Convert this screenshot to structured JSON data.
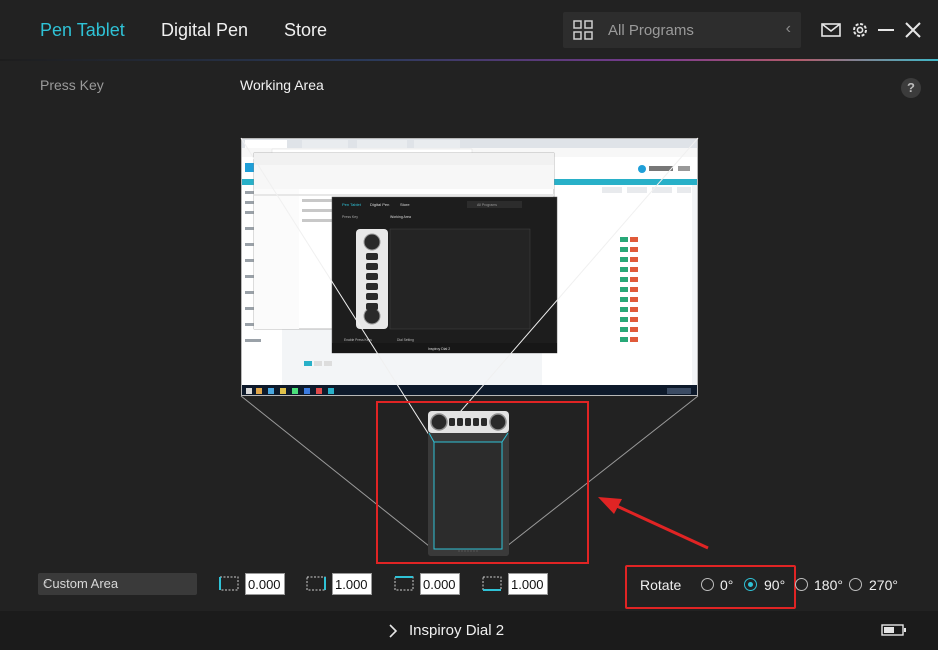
{
  "nav": {
    "tabs": [
      {
        "label": "Pen Tablet"
      },
      {
        "label": "Digital Pen"
      },
      {
        "label": "Store"
      }
    ],
    "program_placeholder": "All Programs"
  },
  "colors": {
    "accent": "#2fc2d6",
    "highlight": "#e02424",
    "background": "#222222"
  },
  "subheader": {
    "press_key": "Press Key",
    "working_area": "Working Area",
    "help": "?"
  },
  "mapping": {
    "area_mode": "Custom Area",
    "values": [
      "0.000",
      "1.000",
      "0.000",
      "1.000"
    ]
  },
  "rotate": {
    "label": "Rotate",
    "options": [
      "0°",
      "90°",
      "180°",
      "270°"
    ],
    "selected": "90°"
  },
  "footer": {
    "device": "Inspiroy Dial 2"
  },
  "screenshot_inner": {
    "tabs": [
      "Pen Tablet",
      "Digital Pen",
      "Store"
    ],
    "search": "All Programs",
    "press_key": "Press Key",
    "working_area": "Working Area",
    "enable": "Enable Press Keys",
    "dial": "Dial Setting",
    "device": "Inspiroy Dial 2"
  }
}
